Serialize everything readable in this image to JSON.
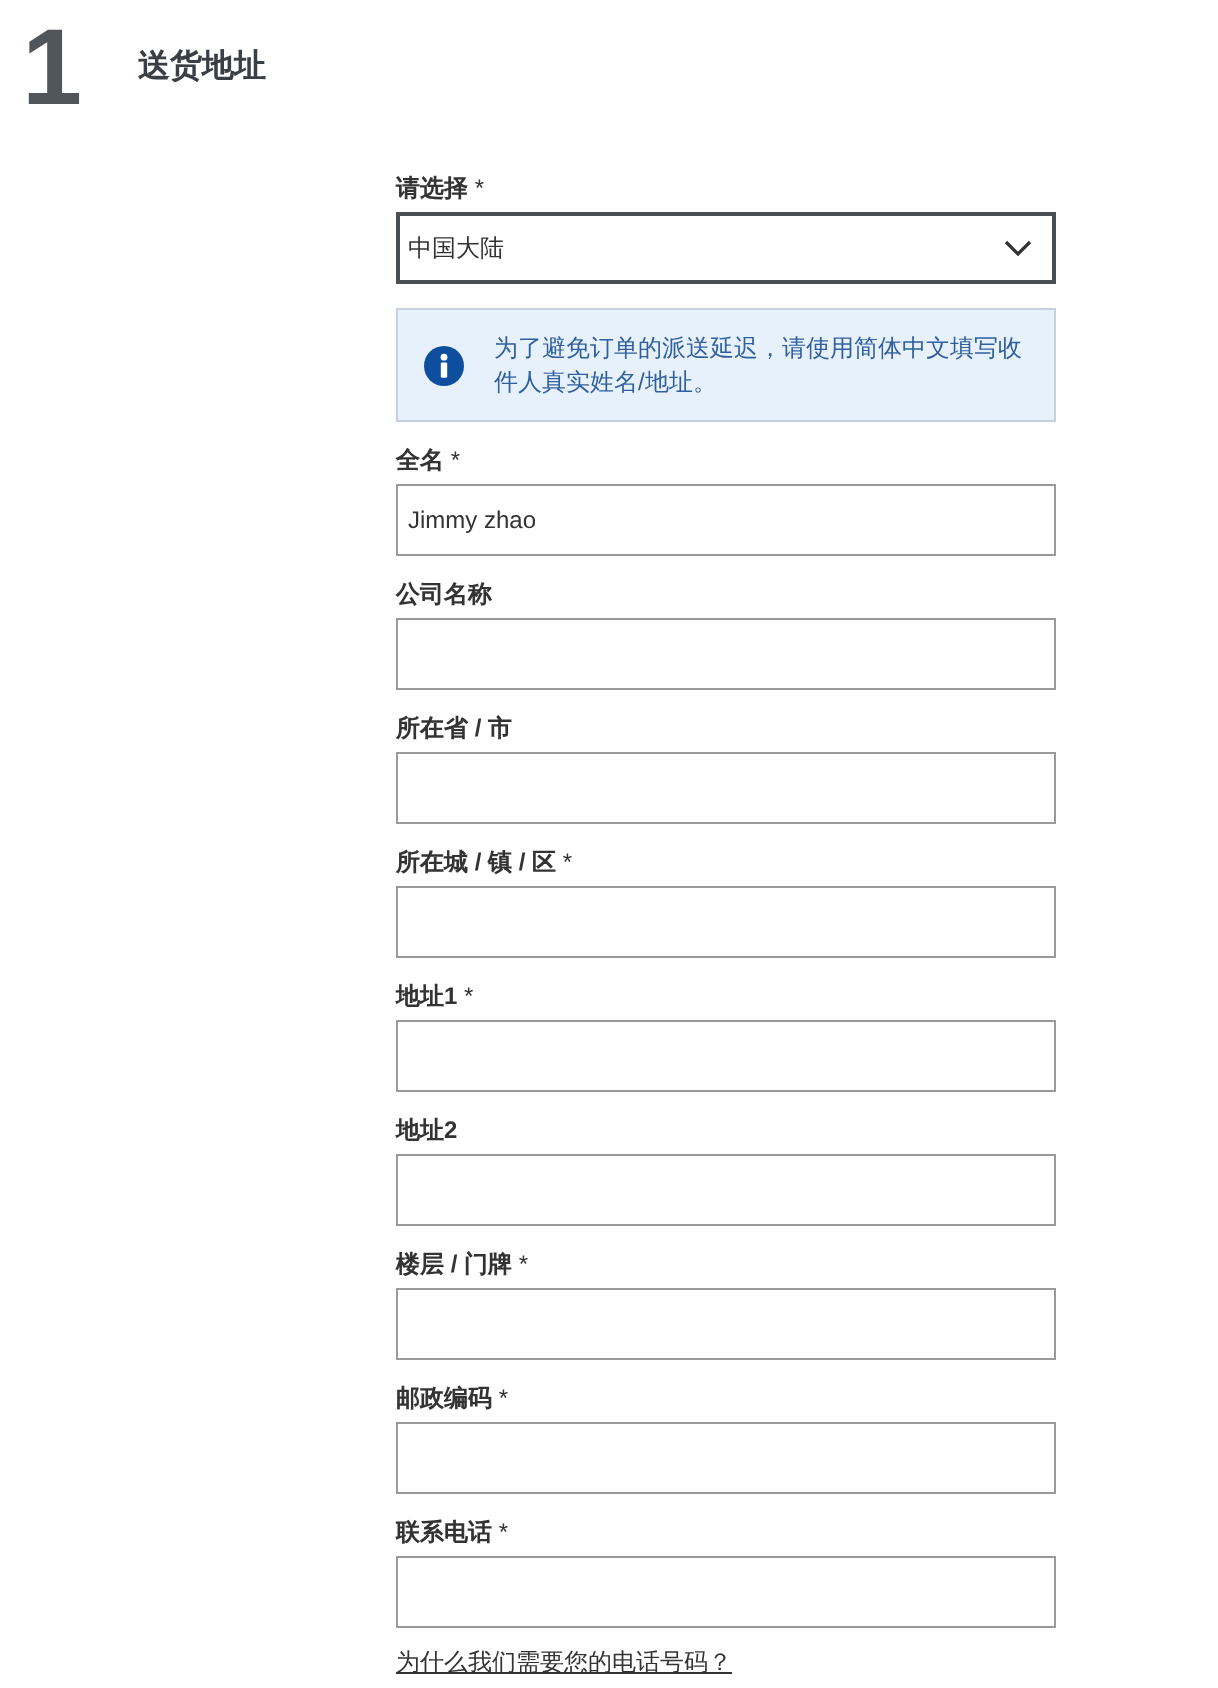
{
  "header": {
    "step": "1",
    "title": "送货地址"
  },
  "country": {
    "label": "**请选择** *",
    "value": "中国大陆"
  },
  "notice": {
    "text": "为了避免订单的派送延迟，请使用简体中文填写收件人真实姓名/地址。"
  },
  "fields": [
    {
      "label": "**全名** *",
      "value": "Jimmy zhao"
    },
    {
      "label": "**公司名称**"
    },
    {
      "label": "**所在省 / 市**"
    },
    {
      "label": "**所在城 / 镇 / 区** *"
    },
    {
      "label": "**地址1** *"
    },
    {
      "label": "**地址2**"
    },
    {
      "label": "**楼层 / 门牌** *"
    },
    {
      "label": "**邮政编码** *"
    },
    {
      "label": "**联系电话** *"
    }
  ],
  "help_link": "为什么我们需要您的电话号码？"
}
